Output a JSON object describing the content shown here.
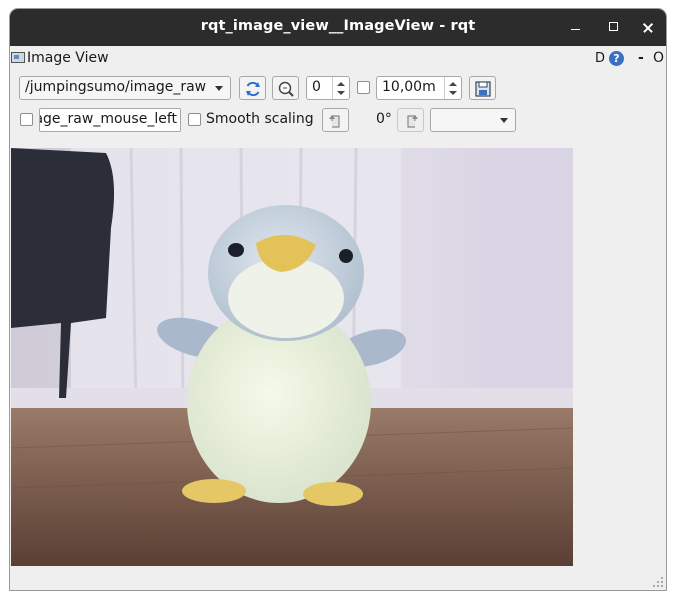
{
  "window": {
    "title": "rqt_image_view__ImageView - rqt"
  },
  "dock": {
    "title": "Image View",
    "d_label": "D",
    "help_label": "?",
    "dash_label": "-",
    "o_label": "O"
  },
  "toolbar1": {
    "topic": "/jumpingsumo/image_raw",
    "num_gridlines": "0",
    "max_depth": "10,00m"
  },
  "toolbar2": {
    "mouse_topic": "age_raw_mouse_left",
    "smooth_scaling_label": "Smooth scaling",
    "rotation": "0°",
    "extra_select": ""
  },
  "colors": {
    "titlebar": "#2c2c2c",
    "window_bg": "#efefef",
    "help_icon": "#3a6fc4",
    "refresh_icon": "#2f6fd0"
  },
  "icons": [
    "window-icon",
    "refresh-icon",
    "zoom-icon",
    "save-icon",
    "rotate-left-icon",
    "rotate-right-icon",
    "help-icon"
  ]
}
